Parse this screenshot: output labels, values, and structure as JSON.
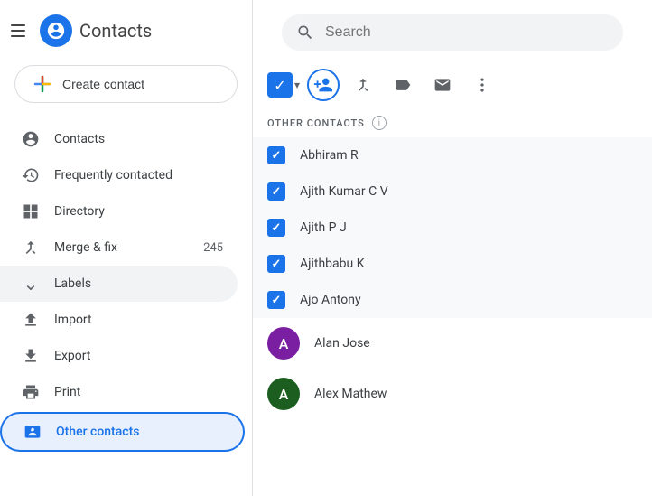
{
  "app": {
    "title": "Contacts"
  },
  "search": {
    "placeholder": "Search"
  },
  "sidebar": {
    "create_label": "Create contact",
    "nav_items": [
      {
        "id": "contacts",
        "label": "Contacts",
        "icon": "person"
      },
      {
        "id": "frequently",
        "label": "Frequently contacted",
        "icon": "history"
      },
      {
        "id": "directory",
        "label": "Directory",
        "icon": "grid"
      },
      {
        "id": "merge",
        "label": "Merge & fix",
        "icon": "merge",
        "badge": "245"
      }
    ],
    "labels_label": "Labels",
    "other_items": [
      {
        "id": "import",
        "label": "Import",
        "icon": "upload"
      },
      {
        "id": "export",
        "label": "Export",
        "icon": "download"
      },
      {
        "id": "print",
        "label": "Print",
        "icon": "print"
      },
      {
        "id": "other-contacts",
        "label": "Other contacts",
        "icon": "contacts",
        "active": true
      }
    ]
  },
  "section": {
    "title": "OTHER CONTACTS",
    "info_tooltip": "Info"
  },
  "contacts": [
    {
      "id": "c1",
      "name": "Abhiram R",
      "checked": true,
      "has_avatar": false
    },
    {
      "id": "c2",
      "name": "Ajith Kumar C V",
      "checked": true,
      "has_avatar": false
    },
    {
      "id": "c3",
      "name": "Ajith P J",
      "checked": true,
      "has_avatar": false
    },
    {
      "id": "c4",
      "name": "Ajithbabu K",
      "checked": true,
      "has_avatar": false
    },
    {
      "id": "c5",
      "name": "Ajo Antony",
      "checked": true,
      "has_avatar": false
    },
    {
      "id": "c6",
      "name": "Alan Jose",
      "checked": false,
      "has_avatar": true,
      "avatar_color": "#7b1fa2",
      "avatar_initial": "A"
    },
    {
      "id": "c7",
      "name": "Alex Mathew",
      "checked": false,
      "has_avatar": true,
      "avatar_color": "#1b5e20",
      "avatar_initial": "A"
    }
  ],
  "toolbar": {
    "add_to_contacts_label": "Add to contacts",
    "merge_label": "Merge",
    "label_label": "Label",
    "email_label": "Email",
    "more_label": "More options"
  }
}
